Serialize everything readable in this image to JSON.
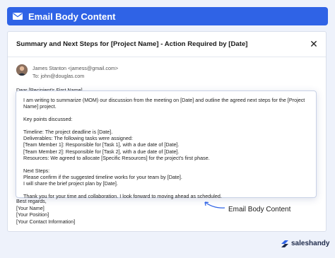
{
  "header": {
    "title": "Email Body Content",
    "icon": "mail-icon"
  },
  "email": {
    "subject": "Summary and Next Steps for [Project Name] - Action Required by [Date]",
    "sender": "James Stanton <jamess@gmail.com>",
    "to": "To: john@douglas.com",
    "greeting": "Dear [Recipient's First Name],",
    "body": {
      "line1": "I am writing to summarize (MOM) our discussion from the meeting on [Date] and outline the agreed next steps for the [Project",
      "line2": "Name] project.",
      "key_points": "Key points discussed:",
      "timeline": "Timeline: The project deadline is [Date].",
      "deliverables": "Deliverables: The following tasks were assigned:",
      "member1": "[Team Member 1]: Responsible for [Task 1], with a due date of [Date].",
      "member2": "[Team Member 2]: Responsible for [Task 2], with a due date of [Date].",
      "resources": "Resources: We agreed to allocate [Specific Resources] for the project's first phase.",
      "next_steps": "Next Steps:",
      "confirm": "Please confirm if the suggested timeline works for your team by [Date].",
      "share": "I will share the brief project plan by [Date].",
      "thanks": "Thank you for your time and collaboration. I look forward to moving ahead as scheduled."
    },
    "signoff": {
      "regards": "Best regards,",
      "name": "[Your Name]",
      "position": "[Your Position]",
      "contact": "[Your Contact Information]"
    }
  },
  "callout": {
    "label": "Email Body Content"
  },
  "brand": {
    "name": "saleshandy"
  },
  "colors": {
    "accent": "#2f63e6",
    "background": "#eef2fb"
  }
}
